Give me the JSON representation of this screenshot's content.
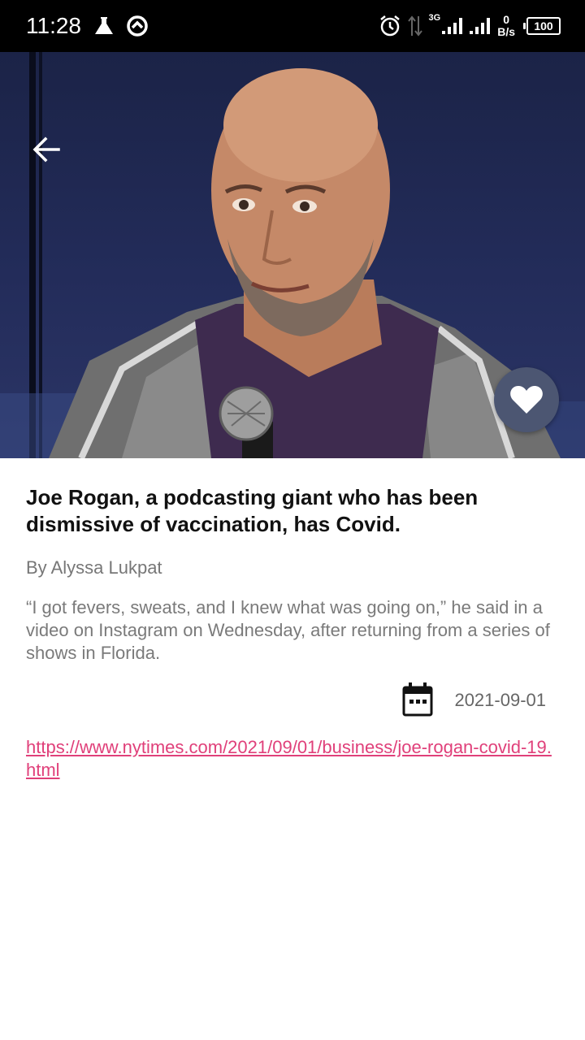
{
  "status_bar": {
    "time": "11:28",
    "network_type": "3G",
    "speed_value": "0",
    "speed_unit": "B/s",
    "battery": "100"
  },
  "hero": {
    "image_icon": "portrait-photo",
    "back_icon": "arrow-left-icon",
    "favorite_icon": "heart-icon"
  },
  "article": {
    "title": "Joe Rogan, a podcasting giant who has been dismissive of vaccination, has Covid.",
    "byline": "By Alyssa Lukpat",
    "excerpt": "“I got fevers, sweats, and I knew what was going on,” he said in a video on Instagram on Wednesday, after returning from a series of shows in Florida.",
    "date": "2021-09-01",
    "url": "https://www.nytimes.com/2021/09/01/business/joe-rogan-covid-19.html"
  },
  "colors": {
    "link": "#e0407a",
    "fab": "#4c5672",
    "status_bar": "#000000"
  }
}
